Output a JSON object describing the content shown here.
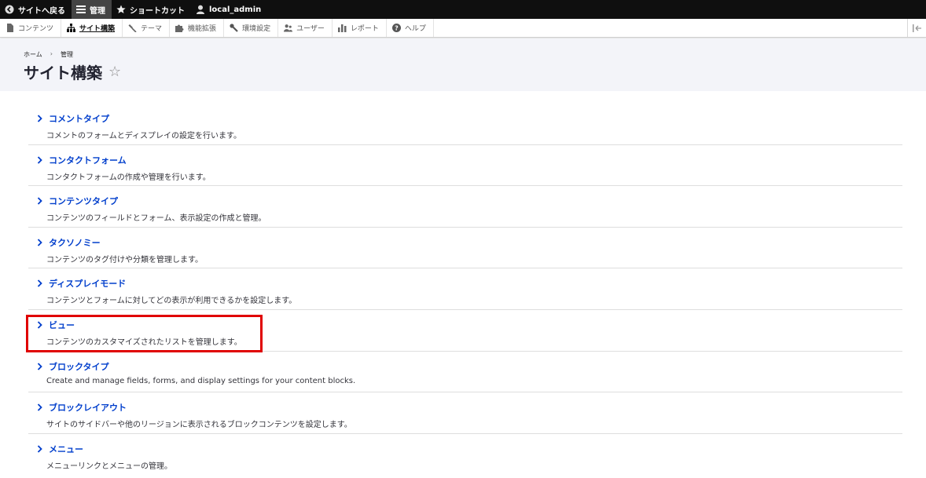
{
  "toolbar": {
    "back_label": "サイトへ戻る",
    "manage_label": "管理",
    "shortcuts_label": "ショートカット",
    "user_label": "local_admin"
  },
  "tray": {
    "items": [
      {
        "label": "コンテンツ",
        "icon": "file-icon"
      },
      {
        "label": "サイト構築",
        "icon": "sitemap-icon"
      },
      {
        "label": "テーマ",
        "icon": "paintbrush-icon"
      },
      {
        "label": "機能拡張",
        "icon": "puzzle-icon"
      },
      {
        "label": "環境設定",
        "icon": "wrench-icon"
      },
      {
        "label": "ユーザー",
        "icon": "people-icon"
      },
      {
        "label": "レポート",
        "icon": "bar-chart-icon"
      },
      {
        "label": "ヘルプ",
        "icon": "help-icon"
      }
    ]
  },
  "breadcrumb": {
    "home": "ホーム",
    "separator": "›",
    "current": "管理"
  },
  "page": {
    "title": "サイト構築",
    "star": "☆"
  },
  "admin_items": [
    {
      "title": "コメントタイプ",
      "desc": "コメントのフォームとディスプレイの設定を行います。"
    },
    {
      "title": "コンタクトフォーム",
      "desc": "コンタクトフォームの作成や管理を行います。"
    },
    {
      "title": "コンテンツタイプ",
      "desc": "コンテンツのフィールドとフォーム、表示設定の作成と管理。"
    },
    {
      "title": "タクソノミー",
      "desc": "コンテンツのタグ付けや分類を管理します。"
    },
    {
      "title": "ディスプレイモード",
      "desc": "コンテンツとフォームに対してどの表示が利用できるかを設定します。"
    },
    {
      "title": "ビュー",
      "desc": "コンテンツのカスタマイズされたリストを管理します。"
    },
    {
      "title": "ブロックタイプ",
      "desc": "Create and manage fields, forms, and display settings for your content blocks."
    },
    {
      "title": "ブロックレイアウト",
      "desc": "サイトのサイドバーや他のリージョンに表示されるブロックコンテンツを設定します。"
    },
    {
      "title": "メニュー",
      "desc": "メニューリンクとメニューの管理。"
    }
  ],
  "colors": {
    "link": "#003ecc",
    "toolbar_bg": "#0f0f0f",
    "header_bg": "#f3f4f9",
    "highlight": "#e00000"
  }
}
